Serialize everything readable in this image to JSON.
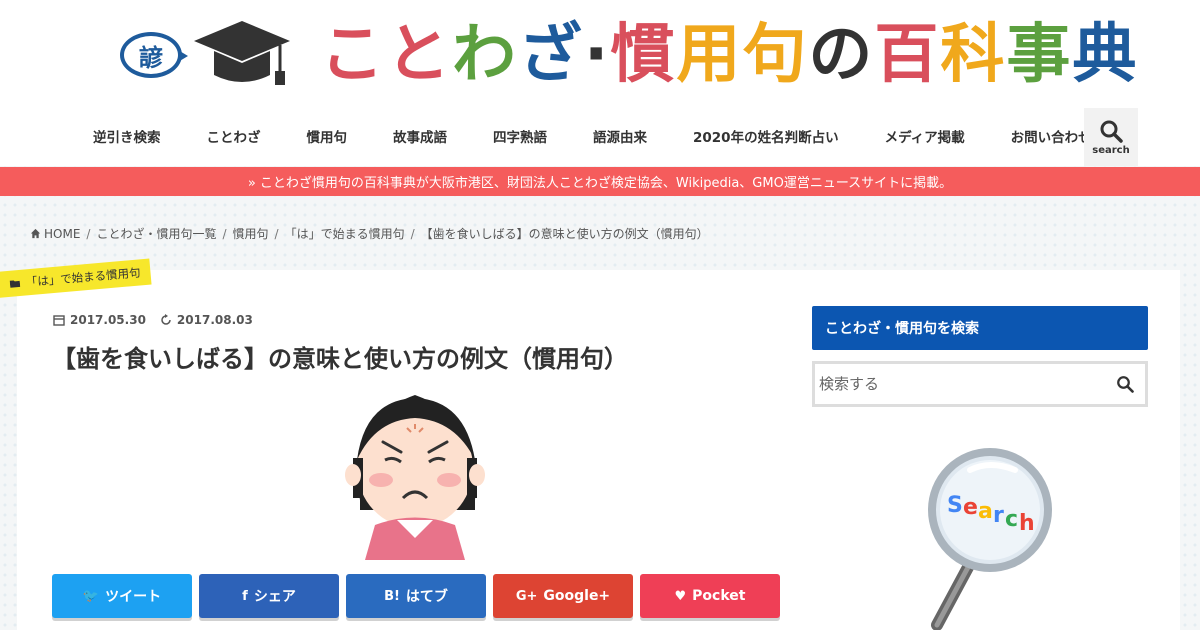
{
  "logo": {
    "badge": "諺",
    "title_chars": [
      {
        "ch": "こ",
        "color": "#d94f5c"
      },
      {
        "ch": "と",
        "color": "#d94f5c"
      },
      {
        "ch": "わ",
        "color": "#5ca03f"
      },
      {
        "ch": "ざ",
        "color": "#1e5b9c"
      },
      {
        "ch": "·",
        "color": "#333333"
      },
      {
        "ch": "慣",
        "color": "#d94f5c"
      },
      {
        "ch": "用",
        "color": "#f0a81c"
      },
      {
        "ch": "句",
        "color": "#f0a81c"
      },
      {
        "ch": "の",
        "color": "#333333"
      },
      {
        "ch": "百",
        "color": "#d94f5c"
      },
      {
        "ch": "科",
        "color": "#f0a81c"
      },
      {
        "ch": "事",
        "color": "#5ca03f"
      },
      {
        "ch": "典",
        "color": "#1e5b9c"
      }
    ]
  },
  "nav": {
    "items": [
      "逆引き検索",
      "ことわざ",
      "慣用句",
      "故事成語",
      "四字熟語",
      "語源由来",
      "2020年の姓名判断占い",
      "メディア掲載",
      "お問い合わせ"
    ],
    "search_label": "search"
  },
  "notice": "» ことわざ慣用句の百科事典が大阪市港区、財団法人ことわざ検定協会、Wikipedia、GMO運営ニュースサイトに掲載。",
  "breadcrumb": [
    "HOME",
    "ことわざ・慣用句一覧",
    "慣用句",
    "「は」で始まる慣用句",
    "【歯を食いしばる】の意味と使い方の例文（慣用句）"
  ],
  "article": {
    "category": "「は」で始まる慣用句",
    "published": "2017.05.30",
    "updated": "2017.08.03",
    "title": "【歯を食いしばる】の意味と使い方の例文（慣用句）"
  },
  "share": [
    {
      "label": "ツイート",
      "icon": "twitter-icon",
      "color": "#1da1f2"
    },
    {
      "label": "シェア",
      "icon": "facebook-icon",
      "color": "#2d62b8"
    },
    {
      "label": "はてブ",
      "icon": "hatena-icon",
      "color": "#2a6bbf"
    },
    {
      "label": "Google+",
      "icon": "googleplus-icon",
      "color": "#dd4433"
    },
    {
      "label": "Pocket",
      "icon": "pocket-icon",
      "color": "#ef3f56"
    }
  ],
  "share_icon_glyphs": {
    "twitter": "🐦",
    "facebook": "f",
    "hatena": "B!",
    "googleplus": "G+",
    "pocket": "♥"
  },
  "sidebar": {
    "heading": "ことわざ・慣用句を検索",
    "search_placeholder": "検索する"
  },
  "colors": {
    "accent_red": "#f55c5c",
    "sidebar_blue": "#0c56b1",
    "category_yellow": "#f7e72b"
  }
}
